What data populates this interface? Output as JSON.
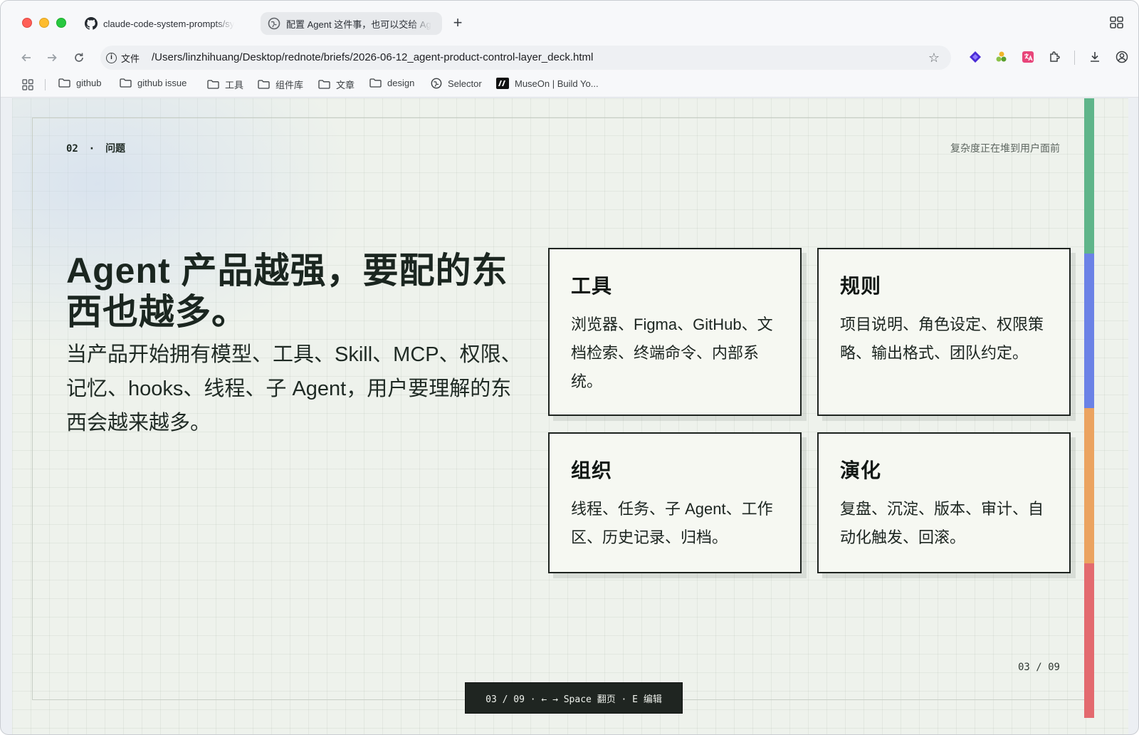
{
  "browser": {
    "tabs": [
      {
        "title": "claude-code-system-prompts/sy",
        "icon": "github-icon",
        "active": false
      },
      {
        "title": "配置 Agent 这件事，也可以交给 Ag",
        "icon": "globe-icon",
        "active": true
      }
    ],
    "new_tab_label": "+",
    "address": {
      "scheme_label": "文件",
      "url": "/Users/linzhihuang/Desktop/rednote/briefs/2026-06-12_agent-product-control-layer_deck.html"
    },
    "bookmarks": [
      {
        "label": "github",
        "icon": "folder-icon"
      },
      {
        "label": "github issue",
        "icon": "folder-icon"
      },
      {
        "label": "工具",
        "icon": "folder-icon"
      },
      {
        "label": "组件库",
        "icon": "folder-icon"
      },
      {
        "label": "文章",
        "icon": "folder-icon"
      },
      {
        "label": "design",
        "icon": "folder-icon"
      },
      {
        "label": "Selector",
        "icon": "globe-icon"
      },
      {
        "label": "MuseOn | Build Yo...",
        "icon": "museon-logo-icon"
      }
    ]
  },
  "slide": {
    "section_number": "02",
    "section_separator": "·",
    "section_title": "问题",
    "top_note": "复杂度正在堆到用户面前",
    "headline": "Agent 产品越强，要配的东西也越多。",
    "body": "当产品开始拥有模型、工具、Skill、MCP、权限、记忆、hooks、线程、子 Agent，用户要理解的东西会越来越多。",
    "cards": [
      {
        "title": "工具",
        "text": "浏览器、Figma、GitHub、文档检索、终端命令、内部系统。"
      },
      {
        "title": "规则",
        "text": "项目说明、角色设定、权限策略、输出格式、团队约定。"
      },
      {
        "title": "组织",
        "text": "线程、任务、子 Agent、工作区、历史记录、归档。"
      },
      {
        "title": "演化",
        "text": "复盘、沉淀、版本、审计、自动化触发、回滚。"
      }
    ],
    "page_indicator": "03 / 09",
    "nav_hint": "03 / 09 · ← → Space 翻页 · E 编辑",
    "accent_colors": [
      "#5fb58a",
      "#6b82e6",
      "#eba360",
      "#e36a6f"
    ]
  }
}
